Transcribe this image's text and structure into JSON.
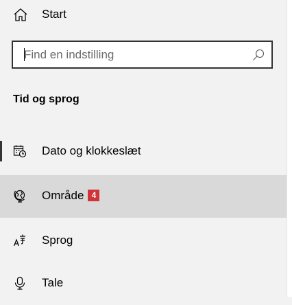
{
  "nav": {
    "start_label": "Start",
    "search_placeholder": "Find en indstilling",
    "section_title": "Tid og sprog",
    "items": [
      {
        "label": "Dato og klokkeslæt",
        "icon": "calendar-clock-icon"
      },
      {
        "label": "Område",
        "icon": "region-globe-icon",
        "badge": "4"
      },
      {
        "label": "Sprog",
        "icon": "language-icon"
      },
      {
        "label": "Tale",
        "icon": "microphone-icon"
      }
    ]
  },
  "colors": {
    "badge": "#d13438",
    "hover": "#d9d9d9",
    "background": "#f2f2f2"
  }
}
